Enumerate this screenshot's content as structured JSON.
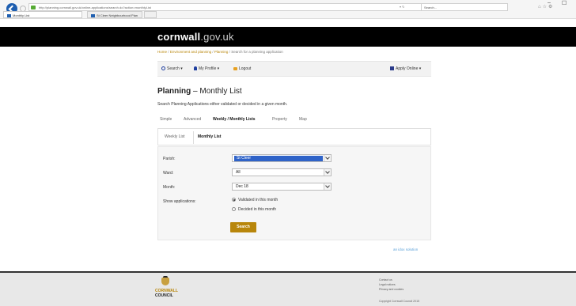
{
  "browser": {
    "address": "http://planning.cornwall.gov.uk/online-applications/search.do?action=monthlyList",
    "search_placeholder": "Search...",
    "tabs": [
      {
        "label": "Monthly List"
      },
      {
        "label": "St Cleer Neighbourhood Plan"
      },
      {
        "label": ""
      }
    ],
    "min_label": "–",
    "max_label": "☐"
  },
  "header": {
    "logo_bold": "cornwall",
    "logo_light": ".gov.uk"
  },
  "breadcrumb": {
    "items": [
      "Home",
      "Environment and planning",
      "Planning",
      "Search for a planning application"
    ],
    "sep": "/"
  },
  "toolbar": {
    "search_label": "Search ▾",
    "profile_label": "My Profile ▾",
    "logout_label": "Logout",
    "apply_label": "Apply Online ▾"
  },
  "page": {
    "title": "Planning",
    "title_dash": " – ",
    "title_suffix": "Monthly List",
    "intro": "Search Planning Applications either validated or decided in a given month."
  },
  "main_tabs": [
    "Simple",
    "Advanced",
    "Weekly / Monthly Lists",
    "Property",
    "Map"
  ],
  "sub_tabs": [
    "Weekly List",
    "Monthly List"
  ],
  "form": {
    "parish_label": "Parish:",
    "parish_value": "St Cleer",
    "ward_label": "Ward:",
    "ward_value": "All",
    "month_label": "Month:",
    "month_value": "Dec 18",
    "show_label": "Show applications:",
    "radio_validated": "Validated in this month",
    "radio_decided": "Decided in this month",
    "search_button": "Search"
  },
  "idox": "an idox solution",
  "footer": {
    "brand_line1": "CORNWALL",
    "brand_line2": "COUNCIL",
    "links": [
      "Contact us",
      "Legal notices",
      "Privacy and cookies"
    ],
    "copyright": "Copyright Cornwall Council 2015"
  }
}
